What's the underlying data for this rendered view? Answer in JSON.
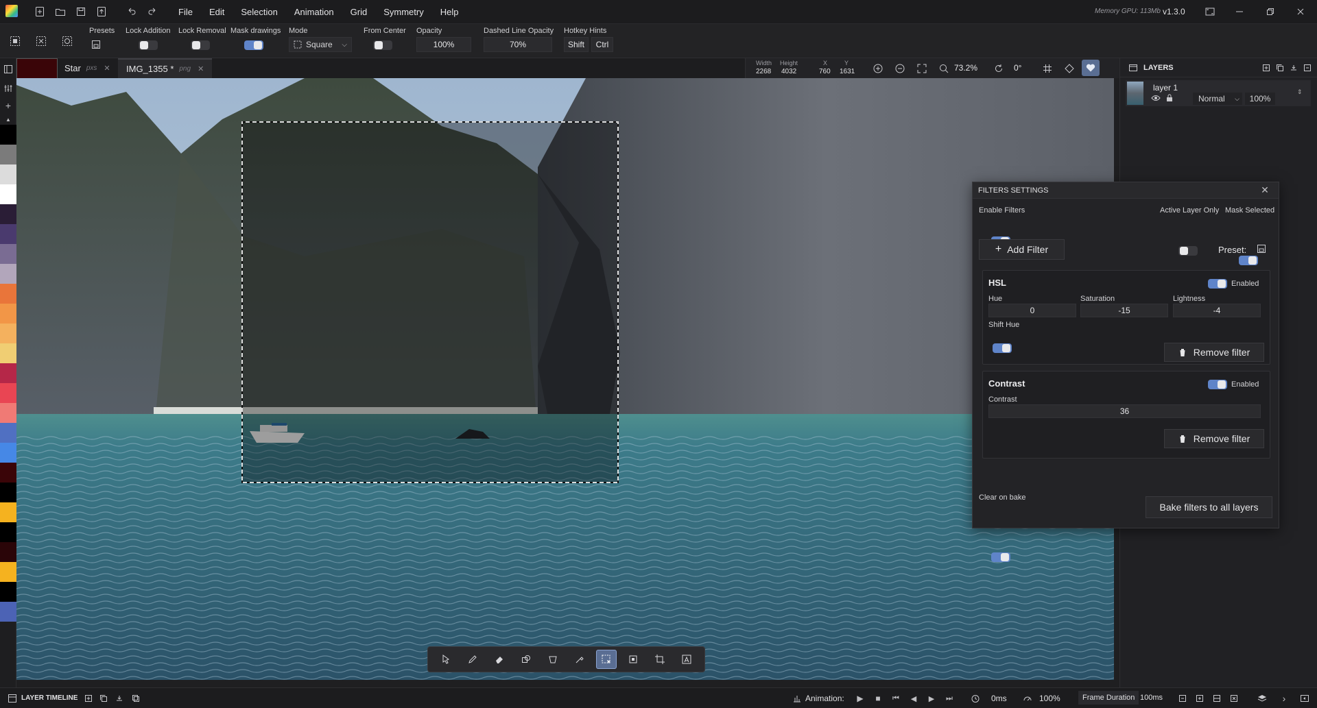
{
  "menu": [
    "File",
    "Edit",
    "Selection",
    "Animation",
    "Grid",
    "Symmetry",
    "Help"
  ],
  "memory": "Memory GPU: 113Mb",
  "version": "v1.3.0",
  "toolbar": {
    "presets": "Presets",
    "lock_addition": "Lock Addition",
    "lock_removal": "Lock Removal",
    "mask_drawings": "Mask drawings",
    "mode_label": "Mode",
    "mode_value": "Square",
    "from_center": "From Center",
    "opacity_label": "Opacity",
    "opacity_value": "100%",
    "dashed_label": "Dashed Line Opacity",
    "dashed_value": "70%",
    "hotkey_label": "Hotkey Hints",
    "hotkey_shift": "Shift",
    "hotkey_ctrl": "Ctrl"
  },
  "tabs": [
    {
      "name": "Star",
      "ext": "pxs"
    },
    {
      "name": "IMG_1355 *",
      "ext": "png"
    }
  ],
  "canvas_info": {
    "width_label": "Width",
    "width": "2268",
    "height_label": "Height",
    "height": "4032",
    "x_label": "X",
    "x": "760",
    "y_label": "Y",
    "y": "1631",
    "zoom": "73.2%",
    "rotation": "0°"
  },
  "layers": {
    "title": "LAYERS",
    "items": [
      {
        "name": "layer 1",
        "blend": "Normal",
        "opacity": "100%"
      }
    ]
  },
  "filters": {
    "title": "FILTERS SETTINGS",
    "enable_filters": "Enable Filters",
    "active_layer_only": "Active Layer Only",
    "mask_selected": "Mask Selected",
    "add_filter": "Add Filter",
    "preset": "Preset:",
    "hsl": {
      "title": "HSL",
      "enabled": "Enabled",
      "hue_label": "Hue",
      "hue": "0",
      "sat_label": "Saturation",
      "sat": "-15",
      "light_label": "Lightness",
      "light": "-4",
      "shift_hue": "Shift Hue",
      "remove": "Remove filter"
    },
    "contrast": {
      "title": "Contrast",
      "enabled": "Enabled",
      "contrast_label": "Contrast",
      "contrast": "36",
      "remove": "Remove filter"
    },
    "clear_on_bake": "Clear on bake",
    "bake": "Bake filters to all layers"
  },
  "bottom": {
    "layer_timeline": "LAYER TIMELINE",
    "animation": "Animation:",
    "time": "0ms",
    "speed": "100%",
    "frame_duration": "Frame Duration",
    "frame_ms": "100ms"
  },
  "colors": {
    "accent": "#5f84c9",
    "primary_color": "#3a0508",
    "swatches": [
      "#000000",
      "#7b7b7b",
      "#dcdcdc",
      "#ffffff",
      "#2a1d36",
      "#4a3a6e",
      "#7a6c93",
      "#b2a6bb",
      "#e9753a",
      "#f29647",
      "#f4b15e",
      "#f0ce73",
      "#b52748",
      "#e94553",
      "#f07a75",
      "#5070c2",
      "#4688e6",
      "#3a0508",
      "#000000",
      "#f5b21f",
      "#000000",
      "#2a0508",
      "#f5b21f",
      "#000000",
      "#4c63b5"
    ]
  }
}
